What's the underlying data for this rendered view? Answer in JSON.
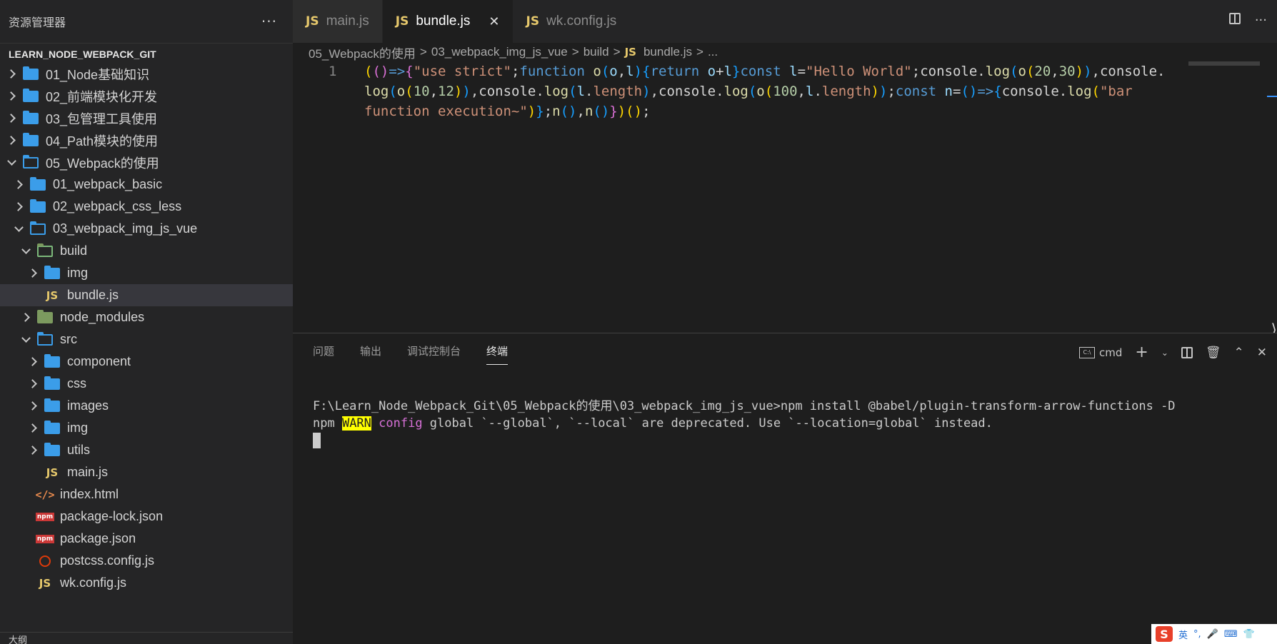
{
  "sidebar": {
    "title": "资源管理器",
    "more": "···",
    "project": "LEARN_NODE_WEBPACK_GIT",
    "outline_label": "大纲",
    "items": [
      {
        "label": "01_Node基础知识",
        "type": "folder",
        "depth": 0,
        "open": false
      },
      {
        "label": "02_前端模块化开发",
        "type": "folder",
        "depth": 0,
        "open": false
      },
      {
        "label": "03_包管理工具使用",
        "type": "folder",
        "depth": 0,
        "open": false
      },
      {
        "label": "04_Path模块的使用",
        "type": "folder",
        "depth": 0,
        "open": false
      },
      {
        "label": "05_Webpack的使用",
        "type": "folder",
        "depth": 0,
        "open": true
      },
      {
        "label": "01_webpack_basic",
        "type": "folder",
        "depth": 1,
        "open": false
      },
      {
        "label": "02_webpack_css_less",
        "type": "folder",
        "depth": 1,
        "open": false
      },
      {
        "label": "03_webpack_img_js_vue",
        "type": "folder",
        "depth": 1,
        "open": true
      },
      {
        "label": "build",
        "type": "folder-special",
        "depth": 2,
        "open": true
      },
      {
        "label": "img",
        "type": "folder",
        "depth": 3,
        "open": false
      },
      {
        "label": "bundle.js",
        "type": "js",
        "depth": 3,
        "selected": true
      },
      {
        "label": "node_modules",
        "type": "folder-special",
        "depth": 2,
        "open": false
      },
      {
        "label": "src",
        "type": "folder",
        "depth": 2,
        "open": true
      },
      {
        "label": "component",
        "type": "folder",
        "depth": 3,
        "open": false
      },
      {
        "label": "css",
        "type": "folder",
        "depth": 3,
        "open": false
      },
      {
        "label": "images",
        "type": "folder",
        "depth": 3,
        "open": false
      },
      {
        "label": "img",
        "type": "folder",
        "depth": 3,
        "open": false
      },
      {
        "label": "utils",
        "type": "folder",
        "depth": 3,
        "open": false
      },
      {
        "label": "main.js",
        "type": "js",
        "depth": 3
      },
      {
        "label": "index.html",
        "type": "html",
        "depth": 2
      },
      {
        "label": "package-lock.json",
        "type": "npm",
        "depth": 2
      },
      {
        "label": "package.json",
        "type": "npm",
        "depth": 2
      },
      {
        "label": "postcss.config.js",
        "type": "postcss",
        "depth": 2
      },
      {
        "label": "wk.config.js",
        "type": "js",
        "depth": 2
      }
    ]
  },
  "tabs": [
    {
      "label": "main.js",
      "active": false
    },
    {
      "label": "bundle.js",
      "active": true,
      "close": "✕"
    },
    {
      "label": "wk.config.js",
      "active": false
    }
  ],
  "js_badge": "JS",
  "breadcrumb": {
    "parts": [
      "05_Webpack的使用",
      "03_webpack_img_js_vue",
      "build",
      "bundle.js",
      "..."
    ],
    "sep": ">"
  },
  "editor": {
    "line_number": "1"
  },
  "panel": {
    "tabs": [
      "问题",
      "输出",
      "调试控制台",
      "终端"
    ],
    "active_tab": "终端",
    "shell_label": "cmd",
    "terminal": {
      "command": "F:\\Learn_Node_Webpack_Git\\05_Webpack的使用\\03_webpack_img_js_vue>npm install @babel/plugin-transform-arrow-functions -D",
      "warn_prefix": "npm ",
      "warn_label": "WARN",
      "warn_keyword": " config",
      "warn_message": " global `--global`, `--local` are deprecated. Use `--location=global` instead."
    }
  },
  "ime": {
    "logo": "S",
    "lang": "英"
  }
}
